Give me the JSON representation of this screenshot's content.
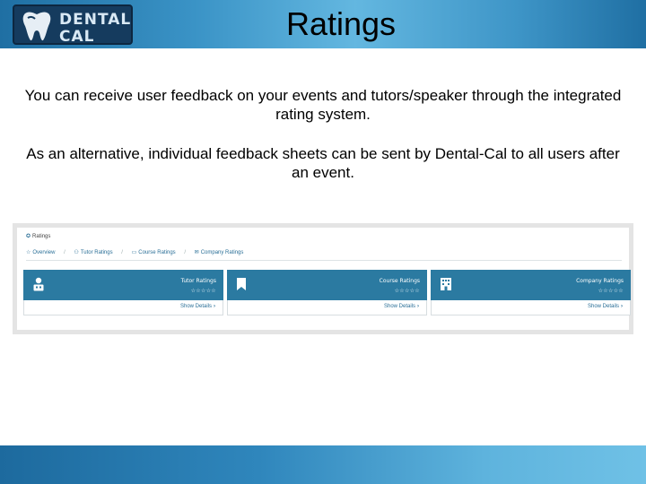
{
  "header": {
    "logo": {
      "line1": "DENTAL",
      "line2": "CAL"
    },
    "title": "Ratings"
  },
  "body": {
    "paragraph1": "You can receive user feedback on your events and tutors/speaker through the integrated rating system.",
    "paragraph2": "As an alternative, individual feedback sheets can be sent by Dental-Cal to all users after an event."
  },
  "screenshot": {
    "title": "Ratings",
    "nav": [
      {
        "label": "Overview",
        "icon": "star-icon"
      },
      {
        "label": "Tutor Ratings",
        "icon": "users-icon"
      },
      {
        "label": "Course Ratings",
        "icon": "chat-icon"
      },
      {
        "label": "Company Ratings",
        "icon": "mail-icon"
      }
    ],
    "cards": [
      {
        "label": "Tutor Ratings",
        "stars": "☆☆☆☆☆",
        "link": "Show Details",
        "icon": "person-icon"
      },
      {
        "label": "Course Ratings",
        "stars": "☆☆☆☆☆",
        "link": "Show Details",
        "icon": "bookmark-icon"
      },
      {
        "label": "Company Ratings",
        "stars": "☆☆☆☆☆",
        "link": "Show Details",
        "icon": "building-icon"
      }
    ]
  },
  "colors": {
    "header_band": "#3a93c6",
    "card_header": "#2b7aa1",
    "link": "#2a6f97"
  }
}
